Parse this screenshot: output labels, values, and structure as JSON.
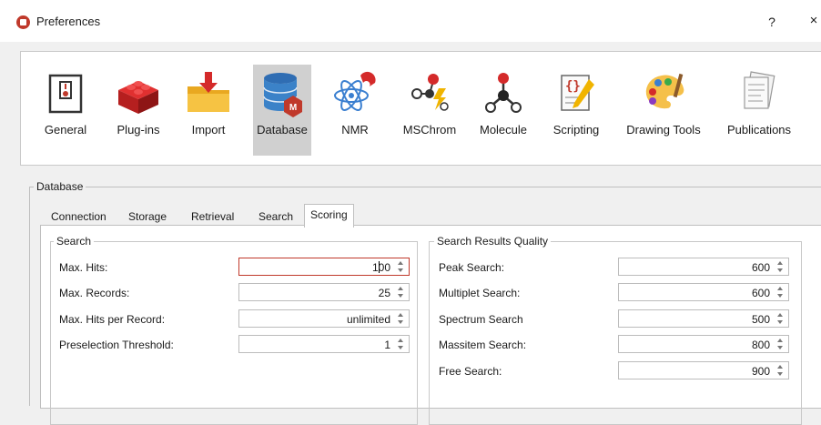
{
  "window": {
    "title": "Preferences",
    "help": "?",
    "close": "×"
  },
  "toolbar": {
    "items": [
      {
        "label": "General",
        "icon": "switch-icon"
      },
      {
        "label": "Plug-ins",
        "icon": "lego-brick-icon"
      },
      {
        "label": "Import",
        "icon": "folder-download-icon"
      },
      {
        "label": "Database",
        "icon": "database-icon",
        "selected": true
      },
      {
        "label": "NMR",
        "icon": "magnet-atom-icon"
      },
      {
        "label": "MSChrom",
        "icon": "molecule-lightning-icon"
      },
      {
        "label": "Molecule",
        "icon": "molecule-icon"
      },
      {
        "label": "Scripting",
        "icon": "script-scroll-icon"
      },
      {
        "label": "Drawing Tools",
        "icon": "palette-icon"
      },
      {
        "label": "Publications",
        "icon": "documents-icon"
      }
    ]
  },
  "group": {
    "title": "Database"
  },
  "tabs": [
    "Connection",
    "Storage",
    "Retrieval",
    "Search",
    "Scoring"
  ],
  "active_tab": "Scoring",
  "search": {
    "title": "Search",
    "fields": [
      {
        "label": "Max. Hits:",
        "value": "100"
      },
      {
        "label": "Max. Records:",
        "value": "25"
      },
      {
        "label": "Max. Hits per Record:",
        "value": "unlimited"
      },
      {
        "label": "Preselection Threshold:",
        "value": "1"
      }
    ]
  },
  "quality": {
    "title": "Search Results Quality",
    "fields": [
      {
        "label": "Peak Search:",
        "value": "600"
      },
      {
        "label": "Multiplet Search:",
        "value": "600"
      },
      {
        "label": "Spectrum Search",
        "value": "500"
      },
      {
        "label": "Massitem Search:",
        "value": "800"
      },
      {
        "label": "Free Search:",
        "value": "900"
      }
    ]
  },
  "colors": {
    "accent": "#c0392b",
    "selected_bg": "#d0d0d0"
  }
}
